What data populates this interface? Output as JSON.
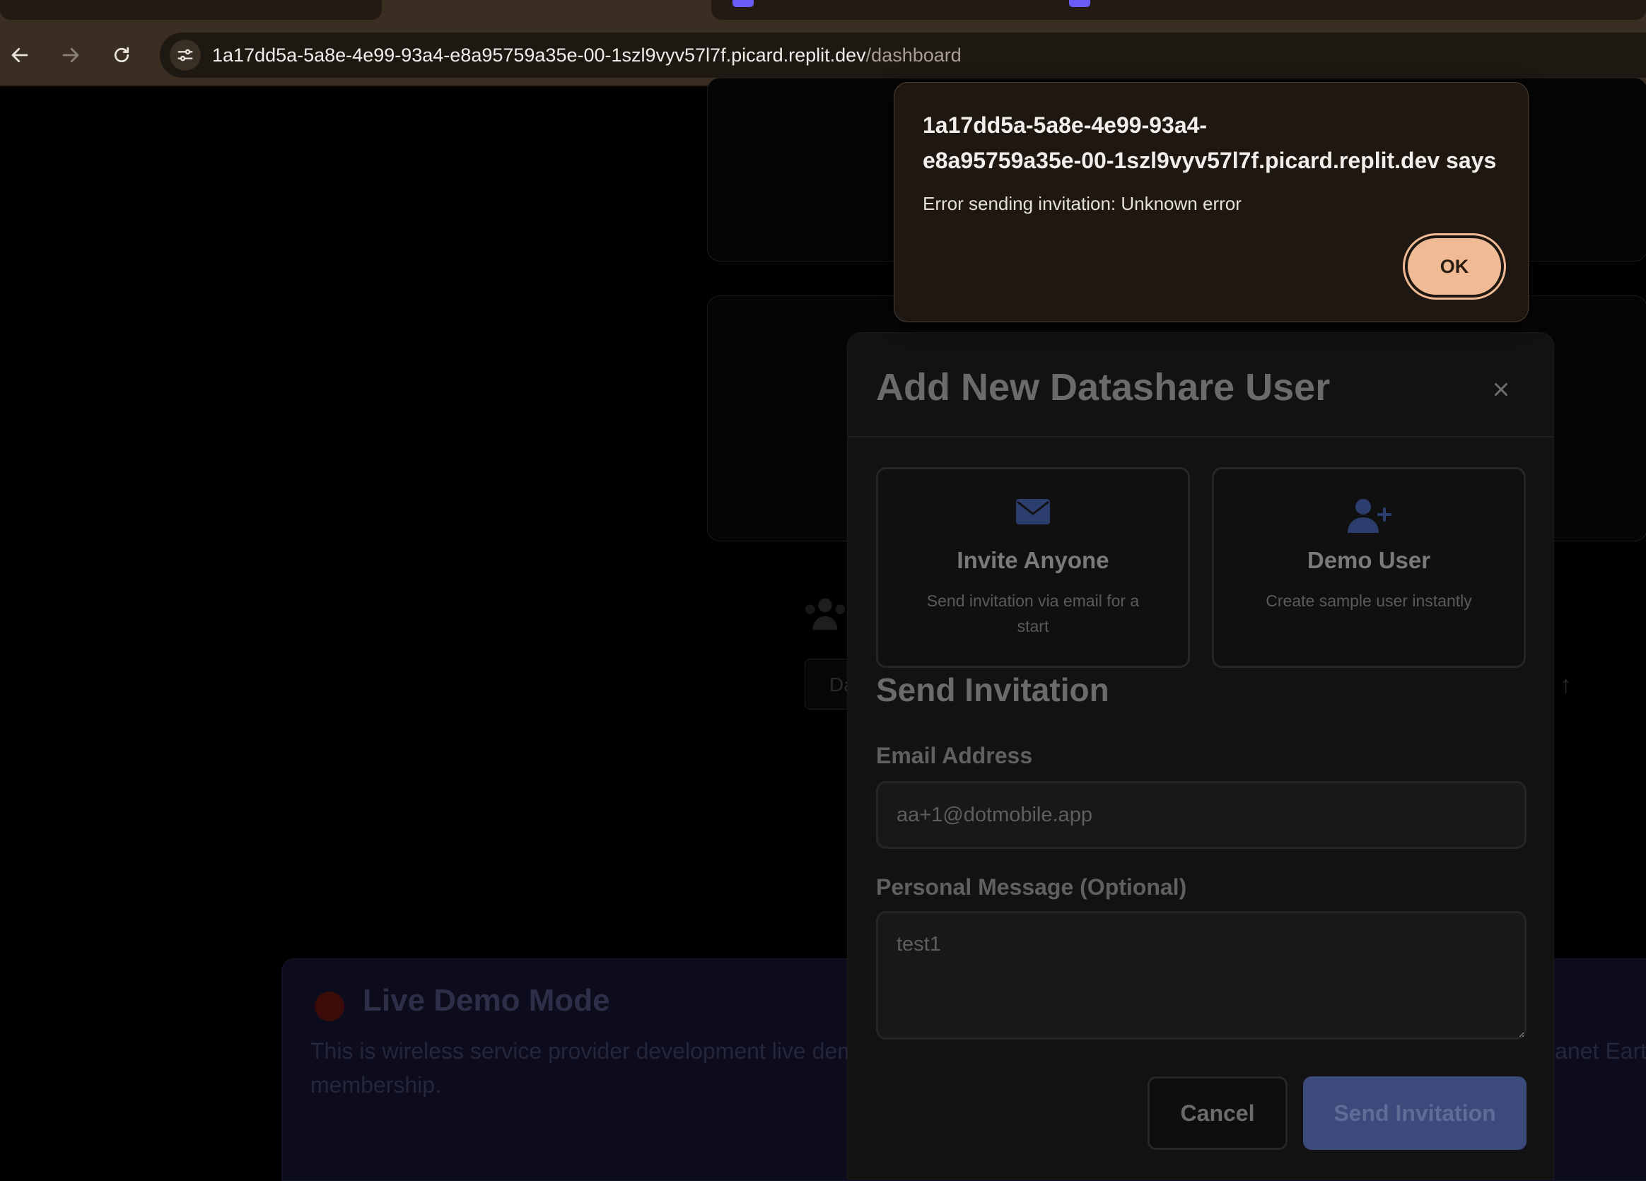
{
  "browser": {
    "url_host": "1a17dd5a-5a8e-4e99-93a4-e8a95759a35e-00-1szl9vyv57l7f.picard.replit.dev",
    "url_path": "/dashboard"
  },
  "background": {
    "demo_title": "Live Demo Mode",
    "demo_text_line1": "This is wireless service provider development live dem",
    "demo_text_line2": "membership.",
    "demo_text_right": "anet Eart",
    "partial_input_text": "Da"
  },
  "modal": {
    "title": "Add New Datashare User",
    "options": [
      {
        "title": "Invite Anyone",
        "desc": "Send invitation via email for a start",
        "icon": "envelope-icon"
      },
      {
        "title": "Demo User",
        "desc": "Create sample user instantly",
        "icon": "user-plus-icon"
      }
    ],
    "section_title": "Send Invitation",
    "email_label": "Email Address",
    "email_value": "aa+1@dotmobile.app",
    "message_label": "Personal Message (Optional)",
    "message_value": "test1",
    "cancel_label": "Cancel",
    "send_label": "Send Invitation"
  },
  "alert": {
    "origin_line1": "1a17dd5a-5a8e-4e99-93a4-",
    "origin_line2": "e8a95759a35e-00-1szl9vyv57l7f.picard.replit.dev says",
    "message": "Error sending invitation: Unknown error",
    "ok_label": "OK"
  },
  "colors": {
    "alert_ok": "#f0bb94",
    "send_button": "#3b4a7a",
    "modal_bg": "#121212",
    "icon_blue": "#2c3e6e"
  }
}
